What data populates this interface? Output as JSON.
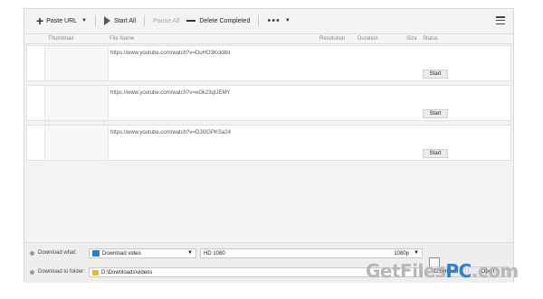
{
  "toolbar": {
    "paste_url": "Paste URL",
    "start_all": "Start All",
    "pause_all": "Pause All",
    "delete_completed": "Delete Completed",
    "more": "•••"
  },
  "table": {
    "columns": [
      "Thumbnail",
      "File Name",
      "Resolution",
      "Duration",
      "Size",
      "Status"
    ],
    "rows": [
      {
        "url": "https://www.youtube.com/watch?v=DuHO3Kck8bI",
        "action": "Start"
      },
      {
        "url": "https://www.youtube.com/watch?v=eOk23qtJEMY",
        "action": "Start"
      },
      {
        "url": "https://www.youtube.com/watch?v=DJI0GPKSa24",
        "action": "Start"
      }
    ]
  },
  "bottom": {
    "download_what_label": "Download what:",
    "download_what_value": "Download video",
    "quality_value": "HD 1080",
    "quality_short": "1080p",
    "download_to_label": "Download to folder:",
    "folder_value": "D:\\Downloads\\videos",
    "download_button": "Download",
    "open_button": "Open"
  },
  "watermark": {
    "part1": "GetFiles",
    "part2": "PC",
    "part3": ".com"
  }
}
